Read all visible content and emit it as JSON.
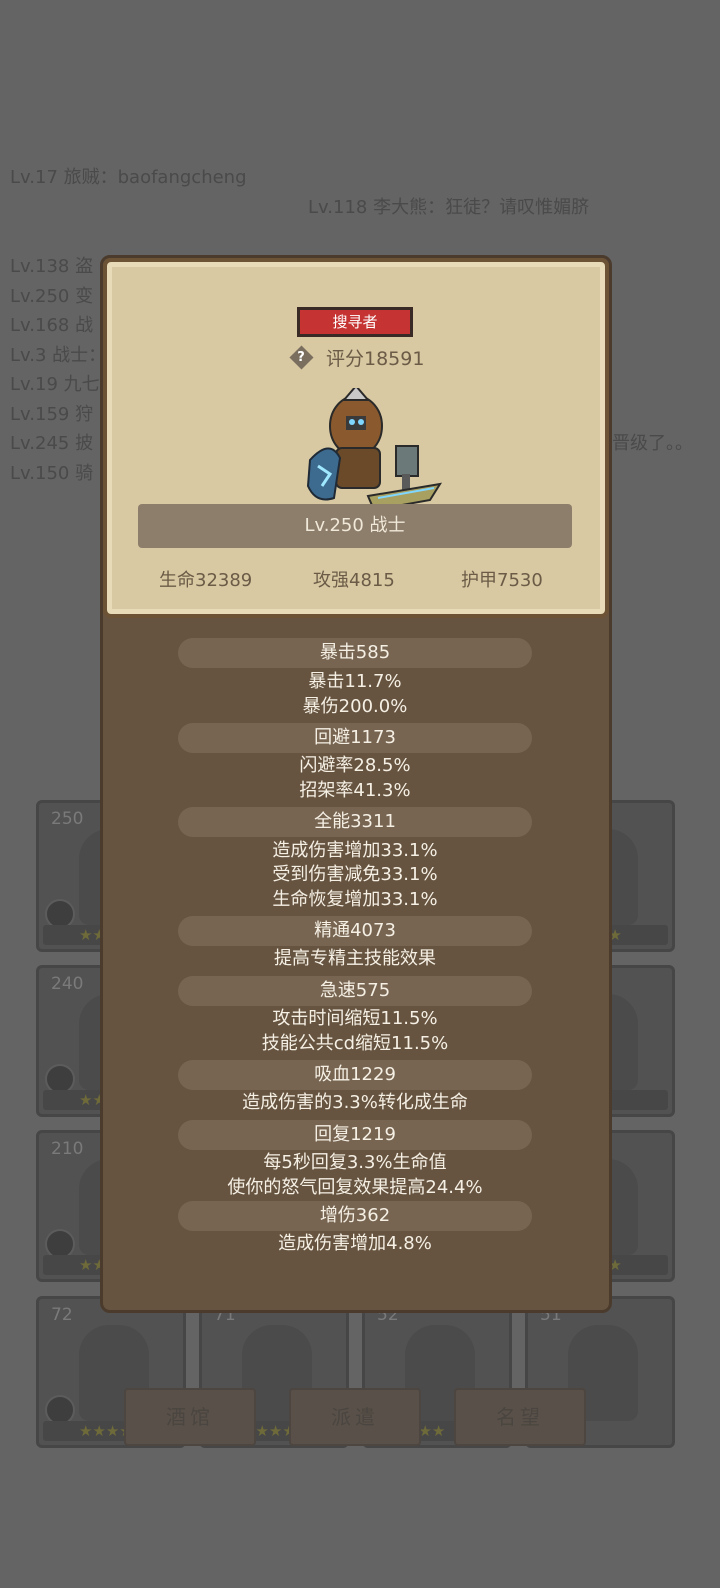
{
  "chat": [
    "Lv.17 旅贼：baofangcheng",
    "Lv.118 李大熊：狂徒？请叹惟媚脐",
    "Lv.138 盗",
    "Lv.250 变",
    "Lv.168 战",
    "Lv.3 战士：",
    "Lv.19 九七",
    "Lv.159 狩",
    "Lv.245 披",
    "Lv.150 骑",
    "晋级了。。"
  ],
  "roster_levels": [
    "250",
    "240",
    "210",
    "72",
    "71",
    "52",
    "51"
  ],
  "roster_stars": [
    "★★★★",
    "★★★★",
    "★★★★",
    "★★★",
    "★★★★",
    "★★★★",
    "★★★★",
    "★★★★",
    "★★★"
  ],
  "bottom_buttons": [
    "酒馆",
    "派遣",
    "名望"
  ],
  "hero": {
    "class_badge": "搜寻者",
    "help_icon": "?",
    "score": "评分18591",
    "name": "Lv.250 战士",
    "hp": "生命32389",
    "atk": "攻强4815",
    "armor": "护甲7530"
  },
  "stats": [
    {
      "label": "暴击585",
      "desc": [
        "暴击11.7%",
        "暴伤200.0%"
      ]
    },
    {
      "label": "回避1173",
      "desc": [
        "闪避率28.5%",
        "招架率41.3%"
      ]
    },
    {
      "label": "全能3311",
      "desc": [
        "造成伤害增加33.1%",
        "受到伤害减免33.1%",
        "生命恢复增加33.1%"
      ]
    },
    {
      "label": "精通4073",
      "desc": [
        "提高专精主技能效果"
      ]
    },
    {
      "label": "急速575",
      "desc": [
        "攻击时间缩短11.5%",
        "技能公共cd缩短11.5%"
      ]
    },
    {
      "label": "吸血1229",
      "desc": [
        "造成伤害的3.3%转化成生命"
      ]
    },
    {
      "label": "回复1219",
      "desc": [
        "每5秒回复3.3%生命值",
        "使你的怒气回复效果提高24.4%"
      ]
    },
    {
      "label": "增伤362",
      "desc": [
        "造成伤害增加4.8%"
      ]
    }
  ],
  "colors": {
    "overlay_bg": "#646464",
    "panel_brown": "#665440",
    "parchment": "#d8c9a2",
    "badge_red": "#c63333",
    "stat_text": "#f5efe4"
  }
}
